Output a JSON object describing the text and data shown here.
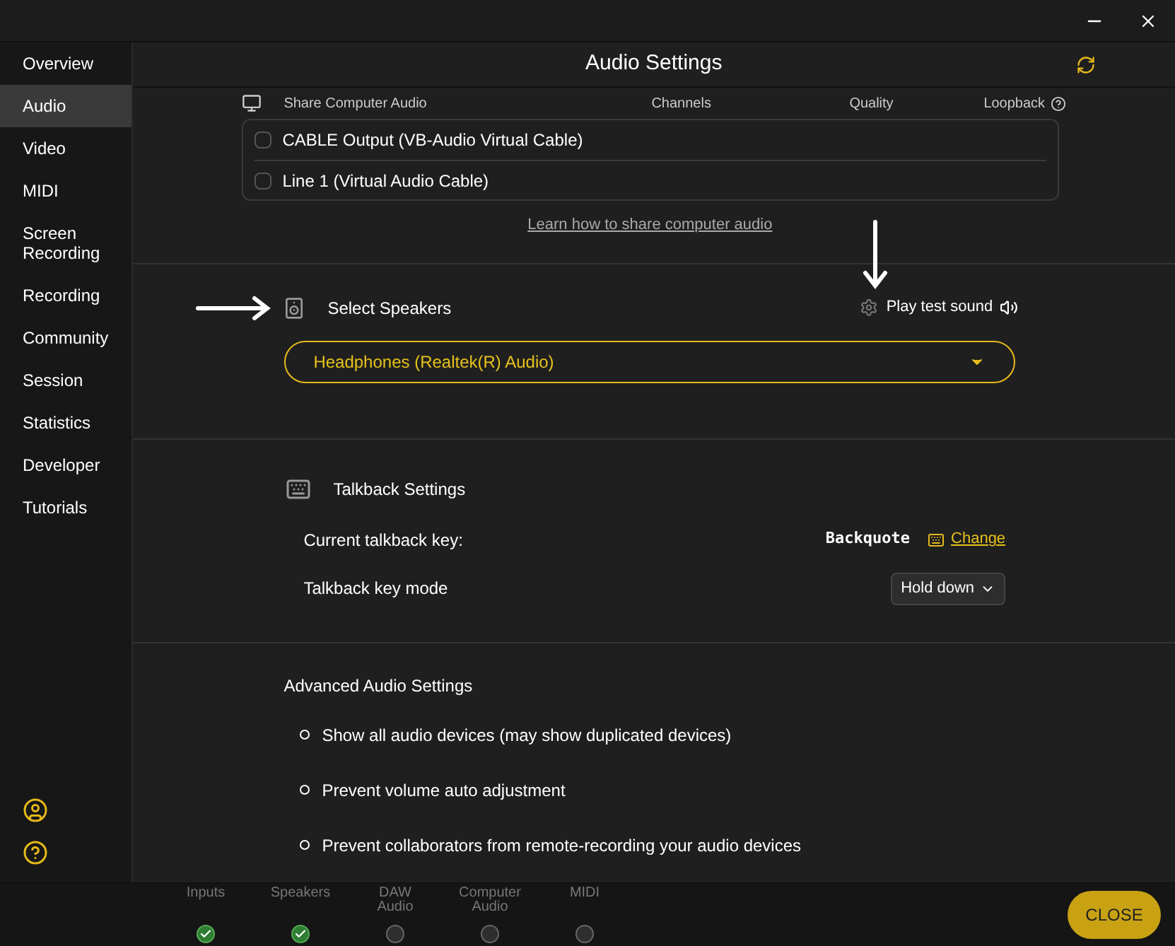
{
  "header": {
    "title": "Audio Settings"
  },
  "sidebar": {
    "items": [
      {
        "label": "Overview",
        "selected": false
      },
      {
        "label": "Audio",
        "selected": true
      },
      {
        "label": "Video",
        "selected": false
      },
      {
        "label": "MIDI",
        "selected": false
      },
      {
        "label": "Screen Recording",
        "selected": false
      },
      {
        "label": "Recording",
        "selected": false
      },
      {
        "label": "Community",
        "selected": false
      },
      {
        "label": "Session",
        "selected": false
      },
      {
        "label": "Statistics",
        "selected": false
      },
      {
        "label": "Developer",
        "selected": false
      },
      {
        "label": "Tutorials",
        "selected": false
      }
    ]
  },
  "share_audio": {
    "title": "Share Computer Audio",
    "columns": [
      "Channels",
      "Quality",
      "Loopback"
    ],
    "devices": [
      {
        "label": "CABLE Output (VB-Audio Virtual Cable)",
        "checked": false
      },
      {
        "label": "Line 1 (Virtual Audio Cable)",
        "checked": false
      }
    ],
    "link": "Learn how to share computer audio"
  },
  "speakers": {
    "label": "Select Speakers",
    "test_label": "Play test sound",
    "device": "Headphones (Realtek(R) Audio)"
  },
  "talkback": {
    "title": "Talkback Settings",
    "key_label": "Current talkback key:",
    "key_value": "Backquote",
    "change_label": "Change",
    "mode_label": "Talkback key mode",
    "mode_value": "Hold down"
  },
  "advanced": {
    "title": "Advanced Audio Settings",
    "options": [
      {
        "label": "Show all audio devices (may show duplicated devices)",
        "checked": false
      },
      {
        "label": "Prevent volume auto adjustment",
        "checked": false
      },
      {
        "label": "Prevent collaborators from remote-recording your audio devices",
        "checked": false
      }
    ]
  },
  "steps": [
    {
      "label": "Inputs",
      "done": true
    },
    {
      "label": "Speakers",
      "done": true
    },
    {
      "label": "DAW Audio",
      "done": false
    },
    {
      "label": "Computer Audio",
      "done": false
    },
    {
      "label": "MIDI",
      "done": false
    }
  ],
  "close_label": "CLOSE"
}
